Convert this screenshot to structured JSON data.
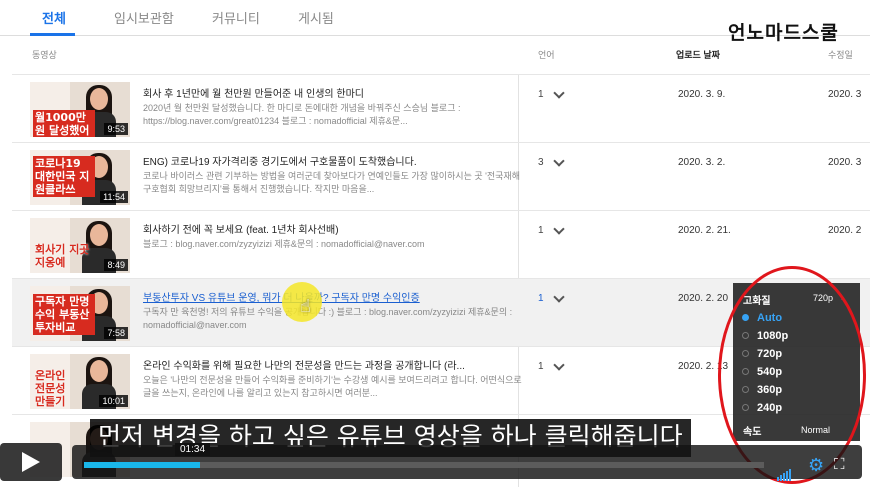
{
  "tabs": [
    {
      "label": "전체",
      "active": true
    },
    {
      "label": "임시보관함",
      "active": false
    },
    {
      "label": "커뮤니티",
      "active": false
    },
    {
      "label": "게시됨",
      "active": false
    }
  ],
  "watermark": "언노마드스쿨",
  "columns": {
    "video": "동영상",
    "language": "언어",
    "upload_date": "업로드 날짜",
    "modified": "수정일"
  },
  "rows": [
    {
      "title": "회사 후 1년만에 월 천만원 만들어준 내 인생의 한마디",
      "desc": "2020년 월 천만원 달성했습니다. 한 마디로 돈에대한 개념을 바꿔주신 스승님 블로그 : https://blog.naver.com/great01234 블로그 : nomadofficial 제휴&문...",
      "caption": "월1000만원 달성했어요",
      "duration": "9:53",
      "lang_count": "1",
      "date": "2020. 3. 9.",
      "date2": "2020. 3"
    },
    {
      "title": "ENG) 코로나19 자가격리중 경기도에서 구호물품이 도착했습니다.",
      "desc": "코로나 바이러스 관련 기부하는 방법을 여러군데 찾아보다가 연예인들도 가장 많이하시는 곳 '전국재해구호협회 희망브리지'를 통해서 진행했습니다. 작지만 마음을...",
      "caption": "코로나19 대한민국 지원클라쓰",
      "duration": "11:54",
      "lang_count": "3",
      "date": "2020. 3. 2.",
      "date2": "2020. 3"
    },
    {
      "title": "회사하기 전에 꼭 보세요 (feat. 1년차 회사선배)",
      "desc": "블로그 : blog.naver.com/zyzyizizi 제휴&문의 : nomadofficial@naver.com",
      "caption": "회사기 지곳지옹예",
      "duration": "8:49",
      "lang_count": "1",
      "date": "2020. 2. 21.",
      "date2": "2020. 2"
    },
    {
      "title": "부동산투자 VS 유튜브 운영, 뭐가 더 나을까? 구독자 만명 수익인증",
      "desc": "구독자 만 육천명! 저의 유튜브 수익을 공개합니다 :) 블로그 : blog.naver.com/zyzyizizi 제휴&문의 : nomadofficial@naver.com",
      "caption": "구독자 만명수익 부동산투자비교",
      "duration": "7:58",
      "lang_count": "1",
      "date": "2020. 2. 20",
      "date2": ""
    },
    {
      "title": "온라인 수익화를 위해 필요한 나만의 전문성을 만드는 과정을 공개합니다 (라...",
      "desc": "오늘은 '나만의 전문성을 만들어 수익화를 준비하기'는 수강생 예시를 보여드리려고 합니다. 어떤식으로 글을 쓰는지, 온라인에 나를 알리고 있는지 참고하시면 여러분...",
      "caption": "온라인 전문성 만들기",
      "duration": "10:01",
      "lang_count": "1",
      "date": "2020. 2. 13",
      "date2": ""
    },
    {
      "title": "",
      "desc": "",
      "caption": "",
      "duration": "",
      "lang_count": "",
      "date": "",
      "date2": ""
    }
  ],
  "settings_menu": {
    "quality_label": "고화질",
    "quality_current": "720p",
    "options": [
      {
        "label": "Auto",
        "selected": true
      },
      {
        "label": "1080p",
        "selected": false
      },
      {
        "label": "720p",
        "selected": false
      },
      {
        "label": "540p",
        "selected": false
      },
      {
        "label": "360p",
        "selected": false
      },
      {
        "label": "240p",
        "selected": false
      }
    ],
    "speed_label": "속도",
    "speed_value": "Normal"
  },
  "subtitle": "먼저 변경을 하고 싶은 유튜브 영상을 하나 클릭해줍니다",
  "player": {
    "current_time": "01:34",
    "progress_fraction": 0.17,
    "accent_color": "#1ab7ea",
    "icons": [
      "play-icon",
      "volume-icon",
      "gear-icon",
      "fullscreen-icon"
    ]
  }
}
